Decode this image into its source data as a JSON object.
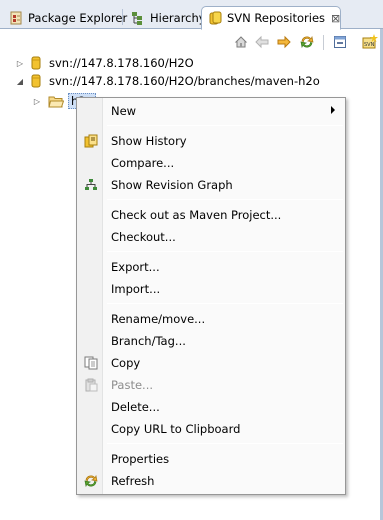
{
  "tabs": [
    {
      "label": "Package Explorer",
      "icon": "package-explorer-icon",
      "active": false
    },
    {
      "label": "Hierarchy",
      "icon": "hierarchy-icon",
      "active": false
    },
    {
      "label": "SVN Repositories",
      "icon": "svn-repositories-icon",
      "active": true,
      "close": "⊠"
    }
  ],
  "toolbar": [
    "home-icon",
    "back-icon",
    "forward-icon",
    "refresh-icon",
    "collapse-all-icon",
    "new-repository-location-icon"
  ],
  "tree": {
    "repo1": {
      "label": "svn://147.8.178.160/H2O",
      "expanded": false
    },
    "repo2": {
      "label": "svn://147.8.178.160/H2O/branches/maven-h2o",
      "expanded": true
    },
    "child": {
      "label": "h2o",
      "expanded": false,
      "selected": true
    }
  },
  "menu": {
    "new": "New",
    "show_history": "Show History",
    "compare": "Compare...",
    "show_revision_graph": "Show Revision Graph",
    "checkout_maven": "Check out as Maven Project...",
    "checkout": "Checkout...",
    "export": "Export...",
    "import": "Import...",
    "rename_move": "Rename/move...",
    "branch_tag": "Branch/Tag...",
    "copy": "Copy",
    "paste": "Paste...",
    "delete": "Delete...",
    "copy_url": "Copy URL to Clipboard",
    "properties": "Properties",
    "refresh": "Refresh"
  },
  "colors": {
    "tab_bar_bg": "#e6ebf3",
    "tab_border": "#9eb0c8",
    "menu_bg": "#fafafa",
    "selection": "#cfe0f7",
    "disabled_text": "#8d8d8d"
  }
}
